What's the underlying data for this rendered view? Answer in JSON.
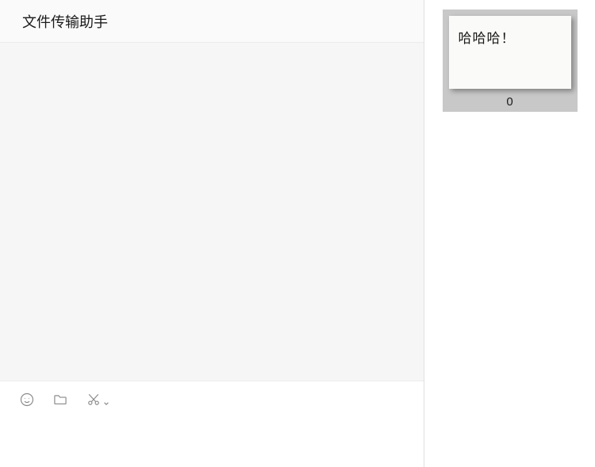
{
  "header": {
    "title": "文件传输助手"
  },
  "toolbar": {
    "emoji_icon": "emoji",
    "folder_icon": "folder",
    "scissors_icon": "scissors"
  },
  "side": {
    "preview_text": "哈哈哈！",
    "preview_count": "0"
  }
}
